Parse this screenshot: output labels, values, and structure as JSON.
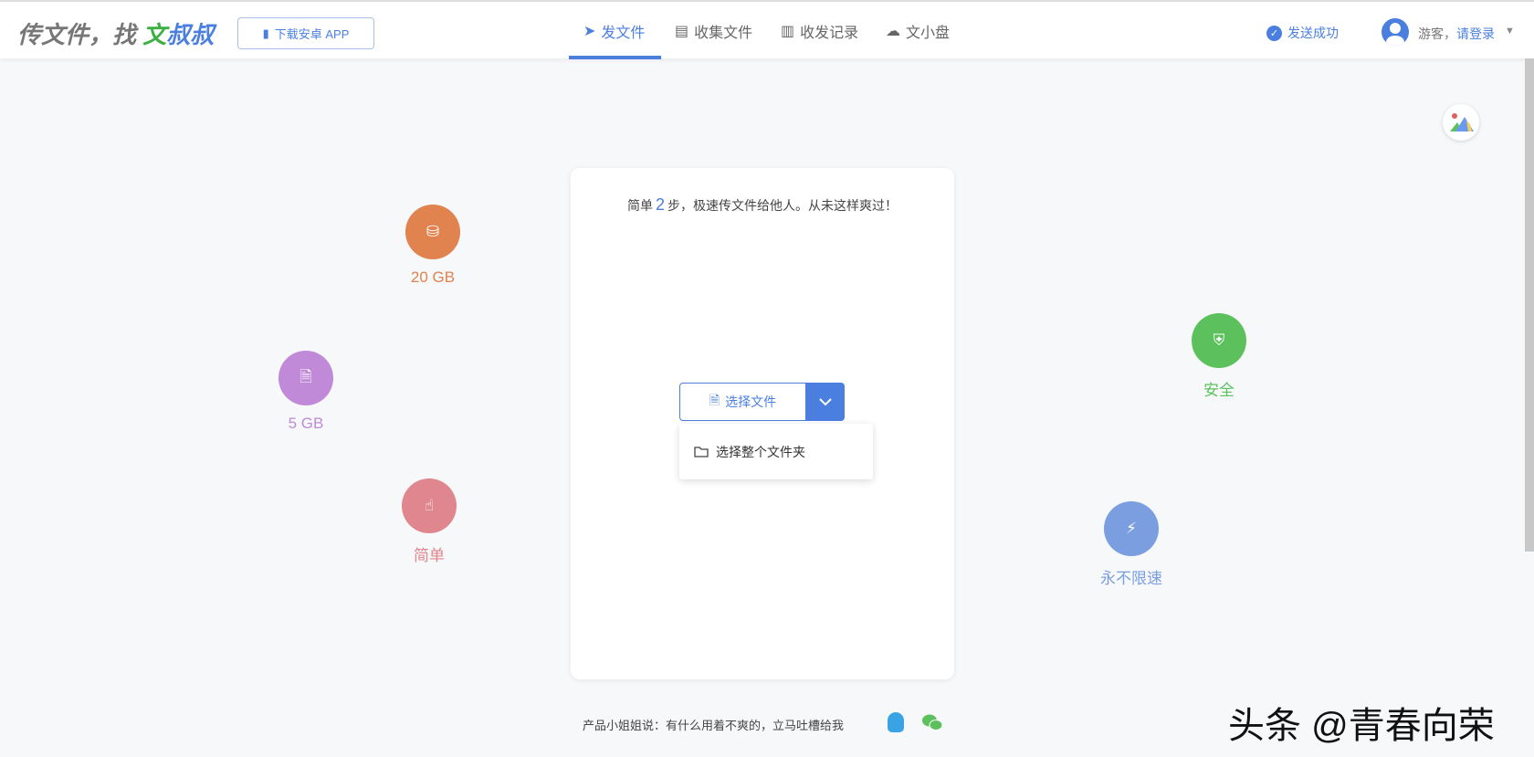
{
  "header": {
    "logo": {
      "part1": "传文件，找 ",
      "part2": "文",
      "part3": "叔叔"
    },
    "download_label": "下载安卓 APP",
    "nav": [
      {
        "label": "发文件",
        "active": true
      },
      {
        "label": "收集文件"
      },
      {
        "label": "收发记录"
      },
      {
        "label": "文小盘"
      }
    ],
    "status": "发送成功",
    "user": {
      "guest": "游客，",
      "login": "请登录"
    }
  },
  "card": {
    "tip_pre": "简单",
    "tip_num": "2",
    "tip_post": "步，极速传文件给他人。从未这样爽过！",
    "select_label": "选择文件",
    "menu_item": "选择整个文件夹"
  },
  "features": [
    {
      "label": "20 GB",
      "color": "#e0834f"
    },
    {
      "label": "5 GB",
      "color": "#c08ad8"
    },
    {
      "label": "简单",
      "color": "#e0868e"
    },
    {
      "label": "安全",
      "color": "#5cc15c"
    },
    {
      "label": "永不限速",
      "color": "#7a9ee0"
    }
  ],
  "footer": {
    "text": "产品小姐姐说：有什么用着不爽的，立马吐槽给我"
  },
  "watermark": "头条 @青春向荣"
}
